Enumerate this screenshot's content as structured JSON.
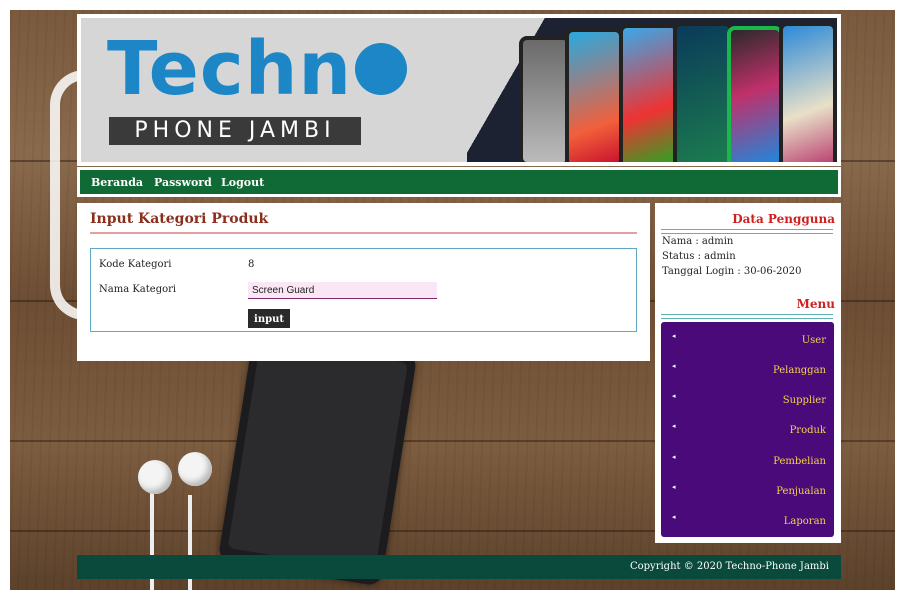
{
  "header": {
    "logo_main": "Techn",
    "logo_sub": "PHONE JAMBI"
  },
  "nav": {
    "items": [
      "Beranda",
      "Password",
      "Logout"
    ]
  },
  "main": {
    "title": "Input Kategori Produk",
    "form": {
      "kode_label": "Kode Kategori",
      "kode_value": "8",
      "nama_label": "Nama Kategori",
      "nama_value": "Screen Guard",
      "submit_label": "input"
    }
  },
  "sidebar": {
    "user_title": "Data Pengguna",
    "nama": "Nama : admin",
    "status": "Status : admin",
    "tanggal": "Tanggal Login : 30-06-2020",
    "menu_title": "Menu",
    "menu_items": [
      "User",
      "Pelanggan",
      "Supplier",
      "Produk",
      "Pembelian",
      "Penjualan",
      "Laporan"
    ]
  },
  "footer": {
    "copyright": "Copyright © 2020 Techno-Phone Jambi"
  },
  "colors": {
    "nav_bg": "#0f6a35",
    "menu_bg": "#4a0a7a",
    "menu_text": "#f2d24a",
    "footer_bg": "#0a4a3c",
    "title": "#8b2e1e",
    "logo": "#1c86c6"
  }
}
